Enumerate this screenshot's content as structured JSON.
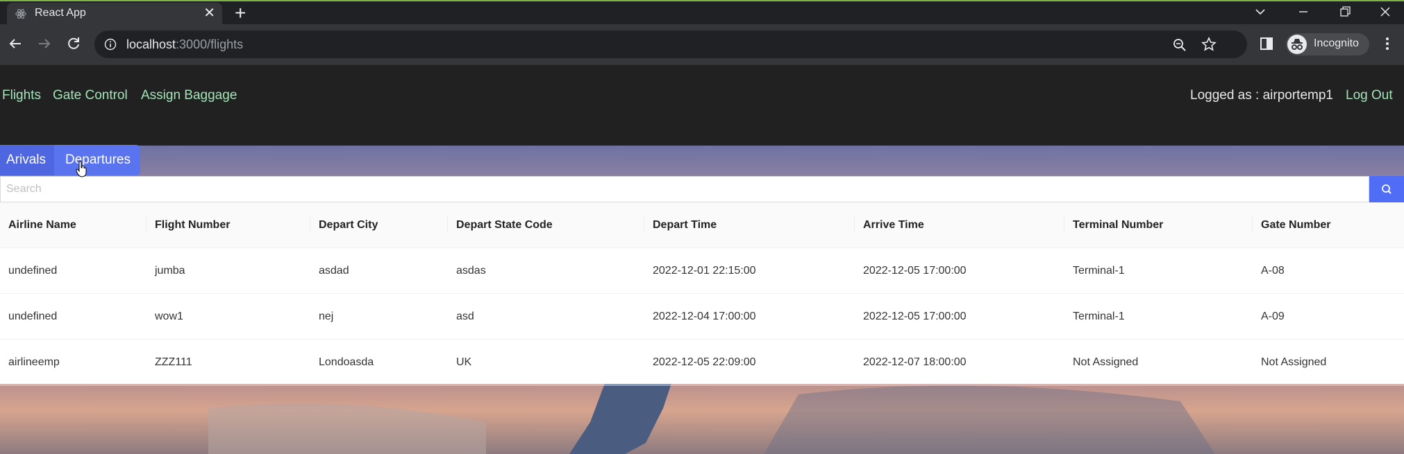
{
  "browser": {
    "tab_title": "React App",
    "url_host": "localhost",
    "url_rest": ":3000/flights",
    "profile_label": "Incognito"
  },
  "navbar": {
    "links": [
      "Flights",
      "Gate Control",
      "Assign Baggage"
    ],
    "logged_as": "Logged as : airportemp1",
    "logout": "Log Out"
  },
  "subtabs": [
    "Arivals",
    "Departures"
  ],
  "search": {
    "placeholder": "Search"
  },
  "table": {
    "columns": [
      "Airline Name",
      "Flight Number",
      "Depart City",
      "Depart State Code",
      "Depart Time",
      "Arrive Time",
      "Terminal Number",
      "Gate Number"
    ],
    "rows": [
      [
        "undefined",
        "jumba",
        "asdad",
        "asdas",
        "2022-12-01 22:15:00",
        "2022-12-05 17:00:00",
        "Terminal-1",
        "A-08"
      ],
      [
        "undefined",
        "wow1",
        "nej",
        "asd",
        "2022-12-04 17:00:00",
        "2022-12-05 17:00:00",
        "Terminal-1",
        "A-09"
      ],
      [
        "airlineemp",
        "ZZZ111",
        "Londoasda",
        "UK",
        "2022-12-05 22:09:00",
        "2022-12-07 18:00:00",
        "Not Assigned",
        "Not Assigned"
      ]
    ]
  },
  "colors": {
    "link": "#a3e4b8",
    "accent": "#5a73ef",
    "navbar_bg": "#212121"
  }
}
